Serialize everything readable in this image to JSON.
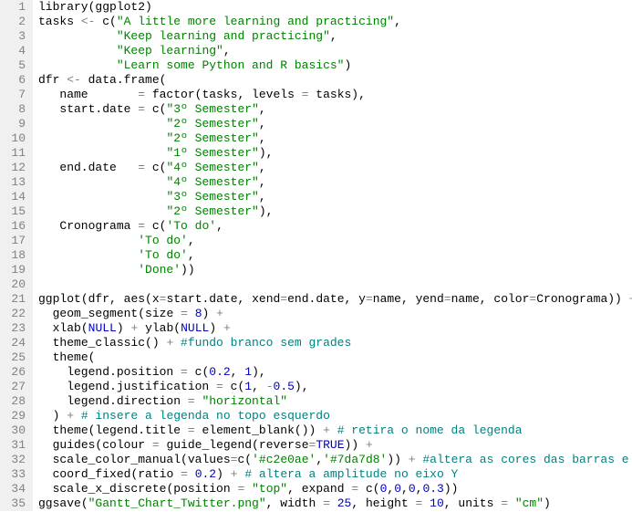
{
  "lines": [
    {
      "n": 1,
      "tokens": [
        [
          "fn",
          "library"
        ],
        [
          "par",
          "("
        ],
        [
          "arg",
          "ggplot2"
        ],
        [
          "par",
          ")"
        ]
      ]
    },
    {
      "n": 2,
      "tokens": [
        [
          "arg",
          "tasks "
        ],
        [
          "op",
          "<-"
        ],
        [
          "fn",
          " c"
        ],
        [
          "par",
          "("
        ],
        [
          "str",
          "\"A little more learning and practicing\""
        ],
        [
          "par",
          ","
        ]
      ]
    },
    {
      "n": 3,
      "tokens": [
        [
          "arg",
          "           "
        ],
        [
          "str",
          "\"Keep learning and practicing\""
        ],
        [
          "par",
          ","
        ]
      ]
    },
    {
      "n": 4,
      "tokens": [
        [
          "arg",
          "           "
        ],
        [
          "str",
          "\"Keep learning\""
        ],
        [
          "par",
          ","
        ]
      ]
    },
    {
      "n": 5,
      "tokens": [
        [
          "arg",
          "           "
        ],
        [
          "str",
          "\"Learn some Python and R basics\""
        ],
        [
          "par",
          ")"
        ]
      ]
    },
    {
      "n": 6,
      "tokens": [
        [
          "arg",
          "dfr "
        ],
        [
          "op",
          "<-"
        ],
        [
          "fn",
          " data.frame"
        ],
        [
          "par",
          "("
        ]
      ]
    },
    {
      "n": 7,
      "tokens": [
        [
          "arg",
          "   name       "
        ],
        [
          "op",
          "="
        ],
        [
          "fn",
          " factor"
        ],
        [
          "par",
          "("
        ],
        [
          "arg",
          "tasks, levels "
        ],
        [
          "op",
          "="
        ],
        [
          "arg",
          " tasks"
        ],
        [
          "par",
          ")"
        ],
        [
          "par",
          ","
        ]
      ]
    },
    {
      "n": 8,
      "tokens": [
        [
          "arg",
          "   start.date "
        ],
        [
          "op",
          "="
        ],
        [
          "fn",
          " c"
        ],
        [
          "par",
          "("
        ],
        [
          "str",
          "\"3º Semester\""
        ],
        [
          "par",
          ","
        ]
      ]
    },
    {
      "n": 9,
      "tokens": [
        [
          "arg",
          "                  "
        ],
        [
          "str",
          "\"2º Semester\""
        ],
        [
          "par",
          ","
        ]
      ]
    },
    {
      "n": 10,
      "tokens": [
        [
          "arg",
          "                  "
        ],
        [
          "str",
          "\"2º Semester\""
        ],
        [
          "par",
          ","
        ]
      ]
    },
    {
      "n": 11,
      "tokens": [
        [
          "arg",
          "                  "
        ],
        [
          "str",
          "\"1º Semester\""
        ],
        [
          "par",
          ")"
        ],
        [
          "par",
          ","
        ]
      ]
    },
    {
      "n": 12,
      "tokens": [
        [
          "arg",
          "   end.date   "
        ],
        [
          "op",
          "="
        ],
        [
          "fn",
          " c"
        ],
        [
          "par",
          "("
        ],
        [
          "str",
          "\"4º Semester\""
        ],
        [
          "par",
          ","
        ]
      ]
    },
    {
      "n": 13,
      "tokens": [
        [
          "arg",
          "                  "
        ],
        [
          "str",
          "\"4º Semester\""
        ],
        [
          "par",
          ","
        ]
      ]
    },
    {
      "n": 14,
      "tokens": [
        [
          "arg",
          "                  "
        ],
        [
          "str",
          "\"3º Semester\""
        ],
        [
          "par",
          ","
        ]
      ]
    },
    {
      "n": 15,
      "tokens": [
        [
          "arg",
          "                  "
        ],
        [
          "str",
          "\"2º Semester\""
        ],
        [
          "par",
          ")"
        ],
        [
          "par",
          ","
        ]
      ]
    },
    {
      "n": 16,
      "tokens": [
        [
          "arg",
          "   Cronograma "
        ],
        [
          "op",
          "="
        ],
        [
          "fn",
          " c"
        ],
        [
          "par",
          "("
        ],
        [
          "str",
          "'To do'"
        ],
        [
          "par",
          ","
        ]
      ]
    },
    {
      "n": 17,
      "tokens": [
        [
          "arg",
          "              "
        ],
        [
          "str",
          "'To do'"
        ],
        [
          "par",
          ","
        ]
      ]
    },
    {
      "n": 18,
      "tokens": [
        [
          "arg",
          "              "
        ],
        [
          "str",
          "'To do'"
        ],
        [
          "par",
          ","
        ]
      ]
    },
    {
      "n": 19,
      "tokens": [
        [
          "arg",
          "              "
        ],
        [
          "str",
          "'Done'"
        ],
        [
          "par",
          "))"
        ]
      ]
    },
    {
      "n": 20,
      "tokens": [
        [
          "arg",
          ""
        ]
      ]
    },
    {
      "n": 21,
      "tokens": [
        [
          "fn",
          "ggplot"
        ],
        [
          "par",
          "("
        ],
        [
          "arg",
          "dfr, "
        ],
        [
          "fn",
          "aes"
        ],
        [
          "par",
          "("
        ],
        [
          "arg",
          "x"
        ],
        [
          "op",
          "="
        ],
        [
          "arg",
          "start.date, xend"
        ],
        [
          "op",
          "="
        ],
        [
          "arg",
          "end.date, y"
        ],
        [
          "op",
          "="
        ],
        [
          "arg",
          "name, yend"
        ],
        [
          "op",
          "="
        ],
        [
          "arg",
          "name, color"
        ],
        [
          "op",
          "="
        ],
        [
          "arg",
          "Cronograma"
        ],
        [
          "par",
          "))"
        ],
        [
          "op",
          " +"
        ]
      ]
    },
    {
      "n": 22,
      "tokens": [
        [
          "arg",
          "  "
        ],
        [
          "fn",
          "geom_segment"
        ],
        [
          "par",
          "("
        ],
        [
          "arg",
          "size "
        ],
        [
          "op",
          "="
        ],
        [
          "arg",
          " "
        ],
        [
          "num",
          "8"
        ],
        [
          "par",
          ")"
        ],
        [
          "op",
          " +"
        ]
      ]
    },
    {
      "n": 23,
      "tokens": [
        [
          "arg",
          "  "
        ],
        [
          "fn",
          "xlab"
        ],
        [
          "par",
          "("
        ],
        [
          "null",
          "NULL"
        ],
        [
          "par",
          ")"
        ],
        [
          "op",
          " + "
        ],
        [
          "fn",
          "ylab"
        ],
        [
          "par",
          "("
        ],
        [
          "null",
          "NULL"
        ],
        [
          "par",
          ")"
        ],
        [
          "op",
          " +"
        ]
      ]
    },
    {
      "n": 24,
      "tokens": [
        [
          "arg",
          "  "
        ],
        [
          "fn",
          "theme_classic"
        ],
        [
          "par",
          "()"
        ],
        [
          "op",
          " + "
        ],
        [
          "cmt",
          "#fundo branco sem grades"
        ]
      ]
    },
    {
      "n": 25,
      "tokens": [
        [
          "arg",
          "  "
        ],
        [
          "fn",
          "theme"
        ],
        [
          "par",
          "("
        ]
      ]
    },
    {
      "n": 26,
      "tokens": [
        [
          "arg",
          "    legend.position "
        ],
        [
          "op",
          "="
        ],
        [
          "fn",
          " c"
        ],
        [
          "par",
          "("
        ],
        [
          "num",
          "0.2"
        ],
        [
          "par",
          ", "
        ],
        [
          "num",
          "1"
        ],
        [
          "par",
          ")"
        ],
        [
          "par",
          ","
        ]
      ]
    },
    {
      "n": 27,
      "tokens": [
        [
          "arg",
          "    legend.justification "
        ],
        [
          "op",
          "="
        ],
        [
          "fn",
          " c"
        ],
        [
          "par",
          "("
        ],
        [
          "num",
          "1"
        ],
        [
          "par",
          ", "
        ],
        [
          "op",
          "-"
        ],
        [
          "num",
          "0.5"
        ],
        [
          "par",
          ")"
        ],
        [
          "par",
          ","
        ]
      ]
    },
    {
      "n": 28,
      "tokens": [
        [
          "arg",
          "    legend.direction "
        ],
        [
          "op",
          "="
        ],
        [
          "arg",
          " "
        ],
        [
          "str",
          "\"horizontal\""
        ]
      ]
    },
    {
      "n": 29,
      "tokens": [
        [
          "arg",
          "  "
        ],
        [
          "par",
          ")"
        ],
        [
          "op",
          " + "
        ],
        [
          "cmt",
          "# insere a legenda no topo esquerdo"
        ]
      ]
    },
    {
      "n": 30,
      "tokens": [
        [
          "arg",
          "  "
        ],
        [
          "fn",
          "theme"
        ],
        [
          "par",
          "("
        ],
        [
          "arg",
          "legend.title "
        ],
        [
          "op",
          "="
        ],
        [
          "fn",
          " element_blank"
        ],
        [
          "par",
          "())"
        ],
        [
          "op",
          " + "
        ],
        [
          "cmt",
          "# retira o nome da legenda"
        ]
      ]
    },
    {
      "n": 31,
      "tokens": [
        [
          "arg",
          "  "
        ],
        [
          "fn",
          "guides"
        ],
        [
          "par",
          "("
        ],
        [
          "arg",
          "colour "
        ],
        [
          "op",
          "="
        ],
        [
          "fn",
          " guide_legend"
        ],
        [
          "par",
          "("
        ],
        [
          "arg",
          "reverse"
        ],
        [
          "op",
          "="
        ],
        [
          "bool",
          "TRUE"
        ],
        [
          "par",
          "))"
        ],
        [
          "op",
          " +"
        ]
      ]
    },
    {
      "n": 32,
      "tokens": [
        [
          "arg",
          "  "
        ],
        [
          "fn",
          "scale_color_manual"
        ],
        [
          "par",
          "("
        ],
        [
          "arg",
          "values"
        ],
        [
          "op",
          "="
        ],
        [
          "fn",
          "c"
        ],
        [
          "par",
          "("
        ],
        [
          "str",
          "'#c2e0ae'"
        ],
        [
          "par",
          ","
        ],
        [
          "str",
          "'#7da7d8'"
        ],
        [
          "par",
          "))"
        ],
        [
          "op",
          " + "
        ],
        [
          "cmt",
          "#altera as cores das barras e legenda"
        ]
      ]
    },
    {
      "n": 33,
      "tokens": [
        [
          "arg",
          "  "
        ],
        [
          "fn",
          "coord_fixed"
        ],
        [
          "par",
          "("
        ],
        [
          "arg",
          "ratio "
        ],
        [
          "op",
          "="
        ],
        [
          "arg",
          " "
        ],
        [
          "num",
          "0.2"
        ],
        [
          "par",
          ")"
        ],
        [
          "op",
          " + "
        ],
        [
          "cmt",
          "# altera a amplitude no eixo Y"
        ]
      ]
    },
    {
      "n": 34,
      "tokens": [
        [
          "arg",
          "  "
        ],
        [
          "fn",
          "scale_x_discrete"
        ],
        [
          "par",
          "("
        ],
        [
          "arg",
          "position "
        ],
        [
          "op",
          "="
        ],
        [
          "arg",
          " "
        ],
        [
          "str",
          "\"top\""
        ],
        [
          "par",
          ", "
        ],
        [
          "arg",
          "expand "
        ],
        [
          "op",
          "="
        ],
        [
          "fn",
          " c"
        ],
        [
          "par",
          "("
        ],
        [
          "num",
          "0"
        ],
        [
          "par",
          ","
        ],
        [
          "num",
          "0"
        ],
        [
          "par",
          ","
        ],
        [
          "num",
          "0"
        ],
        [
          "par",
          ","
        ],
        [
          "num",
          "0.3"
        ],
        [
          "par",
          "))"
        ]
      ]
    },
    {
      "n": 35,
      "tokens": [
        [
          "fn",
          "ggsave"
        ],
        [
          "par",
          "("
        ],
        [
          "str",
          "\"Gantt_Chart_Twitter.png\""
        ],
        [
          "par",
          ", "
        ],
        [
          "arg",
          "width "
        ],
        [
          "op",
          "="
        ],
        [
          "arg",
          " "
        ],
        [
          "num",
          "25"
        ],
        [
          "par",
          ", "
        ],
        [
          "arg",
          "height "
        ],
        [
          "op",
          "="
        ],
        [
          "arg",
          " "
        ],
        [
          "num",
          "10"
        ],
        [
          "par",
          ", "
        ],
        [
          "arg",
          "units "
        ],
        [
          "op",
          "="
        ],
        [
          "arg",
          " "
        ],
        [
          "str",
          "\"cm\""
        ],
        [
          "par",
          ")"
        ]
      ]
    }
  ]
}
